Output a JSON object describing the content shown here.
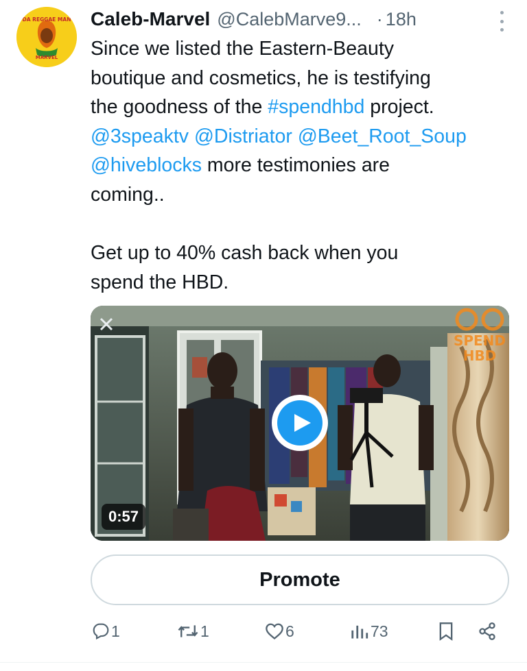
{
  "author": {
    "name": "Caleb-Marvel",
    "handle": "@CalebMarve9...",
    "separator": "·",
    "time": "18h",
    "avatar_text": [
      "DA REGGAE MAN",
      "MARVEL"
    ]
  },
  "tweet": {
    "lines": [
      [
        {
          "t": "Since we listed the Eastern-Beauty",
          "link": false
        }
      ],
      [
        {
          "t": "boutique and cosmetics, he is testifying",
          "link": false
        }
      ],
      [
        {
          "t": "the goodness of the ",
          "link": false
        },
        {
          "t": "#spendhbd",
          "link": true
        },
        {
          "t": " project.",
          "link": false
        }
      ],
      [
        {
          "t": "@3speaktv",
          "link": true
        },
        {
          "t": " ",
          "link": false
        },
        {
          "t": "@Distriator",
          "link": true
        },
        {
          "t": " ",
          "link": false
        },
        {
          "t": "@Beet_Root_Soup",
          "link": true
        }
      ],
      [
        {
          "t": "@hiveblocks",
          "link": true
        },
        {
          "t": " more testimonies are",
          "link": false
        }
      ],
      [
        {
          "t": "coming..",
          "link": false
        }
      ],
      [
        {
          "t": "",
          "link": false
        }
      ],
      [
        {
          "t": "Get up to 40% cash back when you",
          "link": false
        }
      ],
      [
        {
          "t": "spend the HBD.",
          "link": false
        }
      ]
    ]
  },
  "media": {
    "duration": "0:57",
    "watermark_text": [
      "SPEND",
      "HBD"
    ]
  },
  "promote_label": "Promote",
  "actions": {
    "reply_count": "1",
    "retweet_count": "1",
    "like_count": "6",
    "views_count": "73"
  },
  "colors": {
    "link": "#1d9bf0",
    "text": "#0f1419",
    "muted": "#536471",
    "border": "#cfd9de",
    "watermark": "#f28a1e"
  }
}
